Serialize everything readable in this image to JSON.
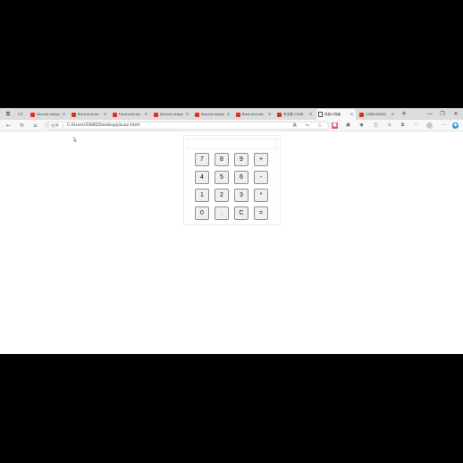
{
  "tabs": [
    {
      "title": "Second assignment",
      "active": false
    },
    {
      "title": "Back-end sec",
      "active": false
    },
    {
      "title": "Front-end sec",
      "active": false
    },
    {
      "title": "Second assignment",
      "active": false
    },
    {
      "title": "Second assignment",
      "active": false
    },
    {
      "title": "Back-end sec",
      "active": false
    },
    {
      "title": "写文章-CSDN",
      "active": false
    },
    {
      "title": "简易计算器",
      "active": true
    },
    {
      "title": "CSDN-MUSIC",
      "active": false
    }
  ],
  "address": {
    "scheme_label": "文件",
    "url": "C:/Users/35685/Desktop/jisuan.html"
  },
  "calculator": {
    "display_value": "",
    "keys": [
      [
        "7",
        "8",
        "9",
        "+"
      ],
      [
        "4",
        "5",
        "6",
        "-"
      ],
      [
        "1",
        "2",
        "3",
        "*"
      ],
      [
        "0",
        ".",
        "C",
        "="
      ]
    ]
  }
}
